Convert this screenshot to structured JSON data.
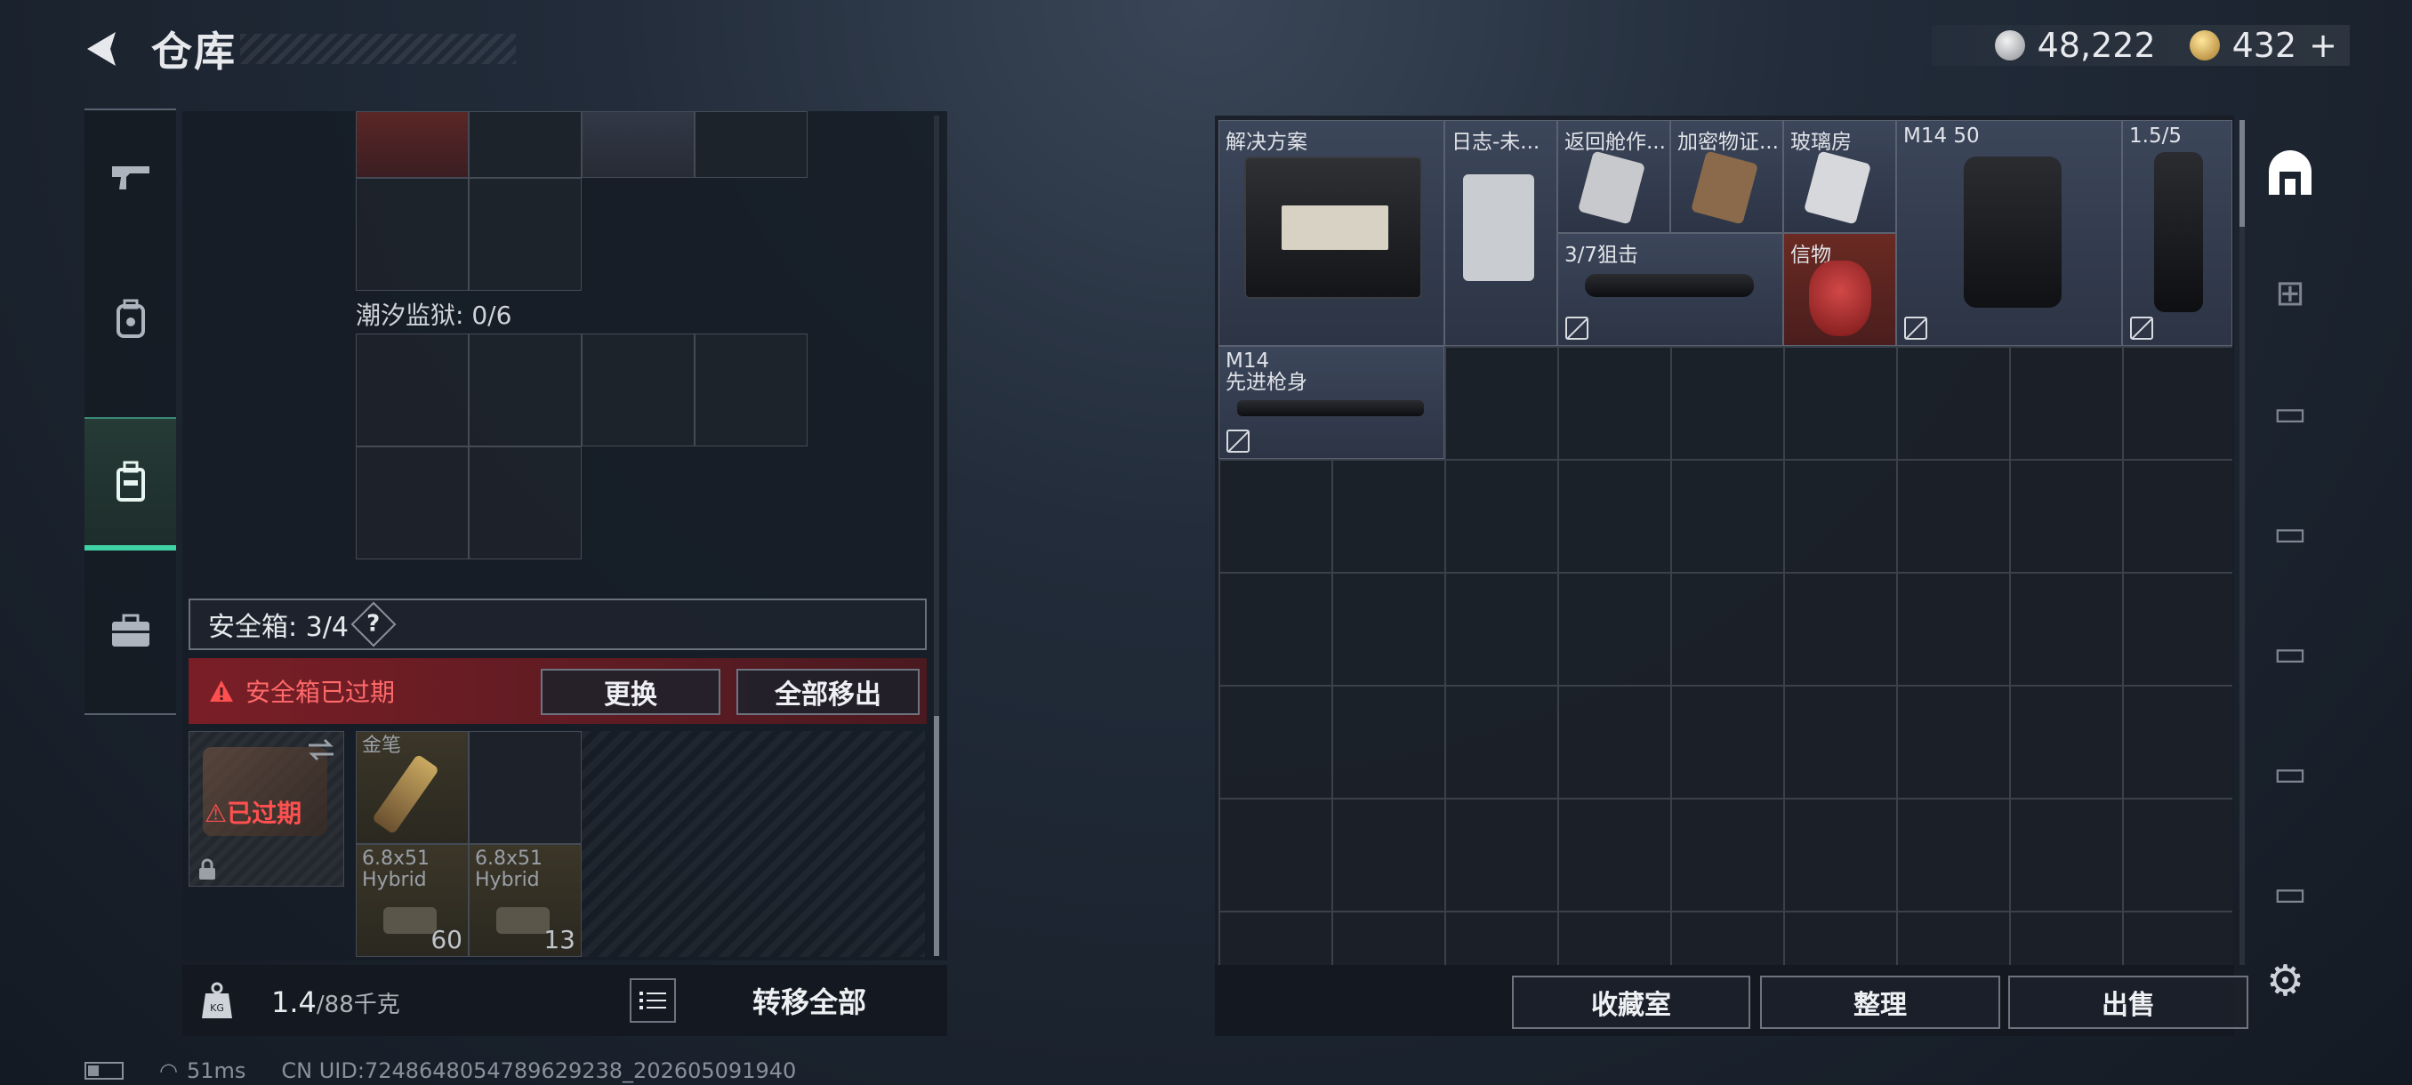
{
  "header": {
    "title": "仓库",
    "currency1": "48,222",
    "currency2": "432",
    "currency2_plus": "+"
  },
  "left_nav": {
    "icons": [
      "gun-icon",
      "backpack-icon",
      "bag-icon",
      "briefcase-icon"
    ],
    "active": 2
  },
  "left_panel": {
    "container_label": "潮汐监狱: 0/6",
    "secure_box_label": "安全箱: 3/4",
    "help_glyph": "?",
    "expired_warning": "安全箱已过期",
    "replace_button": "更换",
    "move_all_button": "全部移出",
    "expired_tag": "已过期",
    "slots": [
      {
        "label": "金笔",
        "count": ""
      },
      {
        "label": "6.8x51\nHybrid",
        "count": "60"
      },
      {
        "label": "6.8x51\nHybrid",
        "count": "13"
      }
    ],
    "weight_current": "1.4",
    "weight_max": "/88千克",
    "transfer_all_button": "转移全部"
  },
  "status_bar": {
    "ping": "51ms",
    "uid": "CN UID:7248648054789629238_202605091940"
  },
  "stash_items": [
    {
      "label": "解决方案"
    },
    {
      "label": "日志-未..."
    },
    {
      "label": "返回舱作..."
    },
    {
      "label": "加密物证..."
    },
    {
      "label": "玻璃房"
    },
    {
      "label": "M14 50"
    },
    {
      "label": "1.5/5"
    },
    {
      "label": "3/7狙击"
    },
    {
      "label": "信物"
    },
    {
      "label": "M14\n先进枪身"
    }
  ],
  "right_actions": {
    "collection": "收藏室",
    "sort": "整理",
    "sell": "出售"
  },
  "right_nav": {
    "tabs": [
      "home-icon",
      "add-stash-icon",
      "stash-v-icon",
      "stash-v-icon",
      "stash-v-icon",
      "stash-iv-icon",
      "stash-iv-icon"
    ]
  }
}
